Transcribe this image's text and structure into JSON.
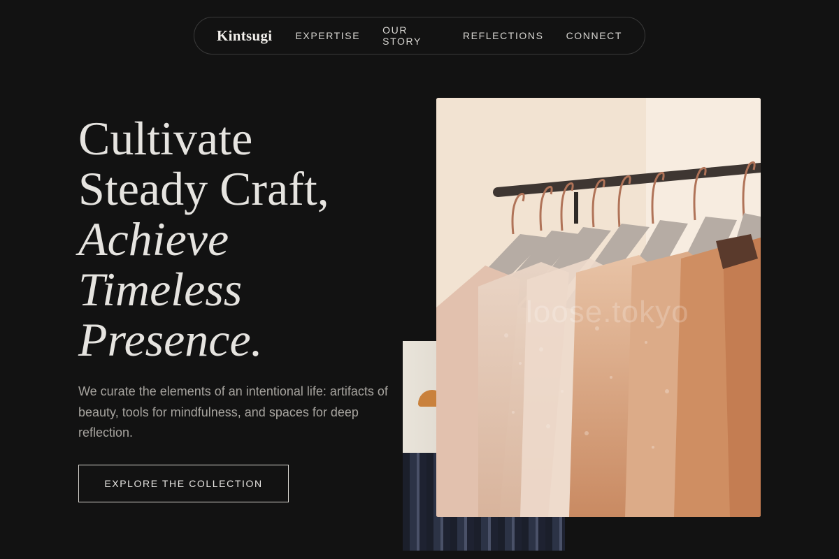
{
  "nav": {
    "brand": "Kintsugi",
    "links": [
      "EXPERTISE",
      "OUR STORY",
      "REFLECTIONS",
      "CONNECT"
    ]
  },
  "hero": {
    "headline": [
      "Cultivate",
      "Steady Craft,",
      "Achieve",
      "Timeless",
      "Presence."
    ],
    "lead": "We curate the elements of an intentional life: artifacts of beauty, tools for mindfulness, and spaces for deep reflection.",
    "cta": "EXPLORE THE COLLECTION"
  },
  "images": {
    "front_watermark": "loose.tokyo"
  },
  "colors": {
    "background": "#121212",
    "text": "#e8e6e3",
    "muted": "#a7a49f"
  }
}
